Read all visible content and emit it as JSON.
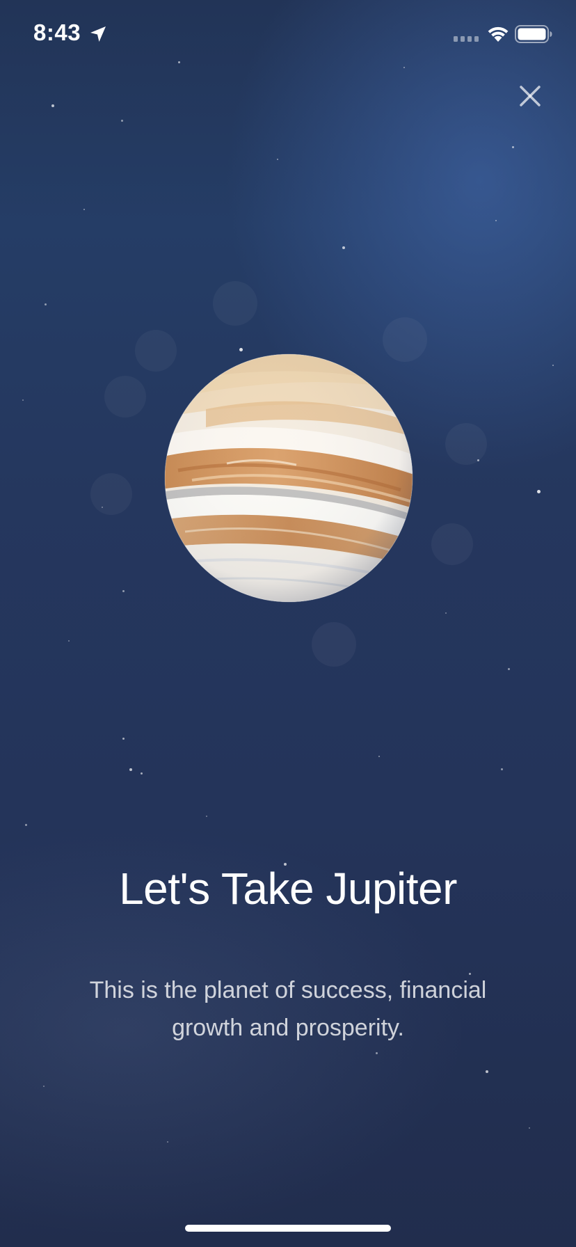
{
  "status_bar": {
    "time": "8:43",
    "location_icon": "location-arrow-icon",
    "signal_icon": "cellular-signal-icon",
    "wifi_icon": "wifi-icon",
    "battery_icon": "battery-icon"
  },
  "header": {
    "close_icon": "close-icon"
  },
  "planet": {
    "icon": "jupiter-planet-image"
  },
  "content": {
    "title": "Let's Take Jupiter",
    "description": "This is the planet of success, financial growth and prosperity."
  },
  "colors": {
    "background_top": "#253d66",
    "background_bottom": "#212d4d",
    "text_primary": "#ffffff",
    "planet_band_orange": "#d49a63",
    "planet_cream": "#f3e8d8"
  }
}
